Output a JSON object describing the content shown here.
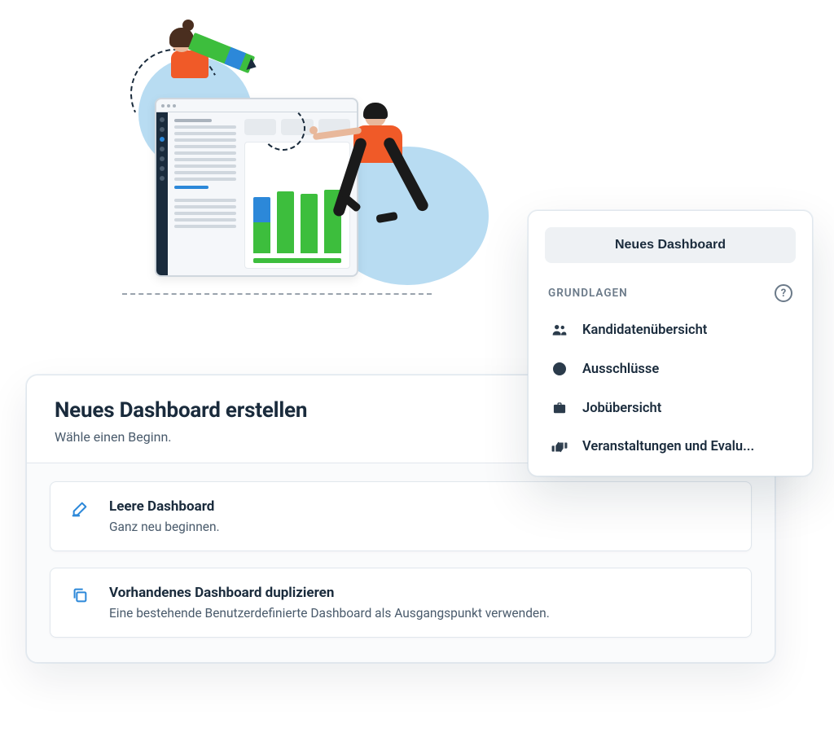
{
  "illustration": {
    "alt": "Two people assembling a dashboard"
  },
  "main": {
    "title": "Neues Dashboard erstellen",
    "subtitle": "Wähle einen Beginn.",
    "options": [
      {
        "icon": "pencil-icon",
        "title": "Leere Dashboard",
        "desc": "Ganz neu beginnen."
      },
      {
        "icon": "duplicate-icon",
        "title": "Vorhandenes Dashboard duplizieren",
        "desc": "Eine bestehende Benutzerdefinierte Dashboard als Ausgangspunkt verwenden."
      }
    ]
  },
  "side": {
    "new_button": "Neues Dashboard",
    "section_label": "GRUNDLAGEN",
    "help_tooltip": "?",
    "items": [
      {
        "icon": "people-icon",
        "label": "Kandidatenübersicht"
      },
      {
        "icon": "prohibit-icon",
        "label": "Ausschlüsse"
      },
      {
        "icon": "briefcase-icon",
        "label": "Jobübersicht"
      },
      {
        "icon": "thumbs-icon",
        "label": "Veranstaltungen und Evalu..."
      }
    ]
  },
  "icons": {
    "pencil": "pencil-icon",
    "duplicate": "duplicate-icon",
    "people": "people-icon",
    "prohibit": "prohibit-icon",
    "briefcase": "briefcase-icon",
    "thumbs": "thumbs-icon",
    "help": "help-icon"
  },
  "colors": {
    "accent": "#2C88D9",
    "text_primary": "#1a2b3c",
    "text_secondary": "#4a5b6c"
  }
}
